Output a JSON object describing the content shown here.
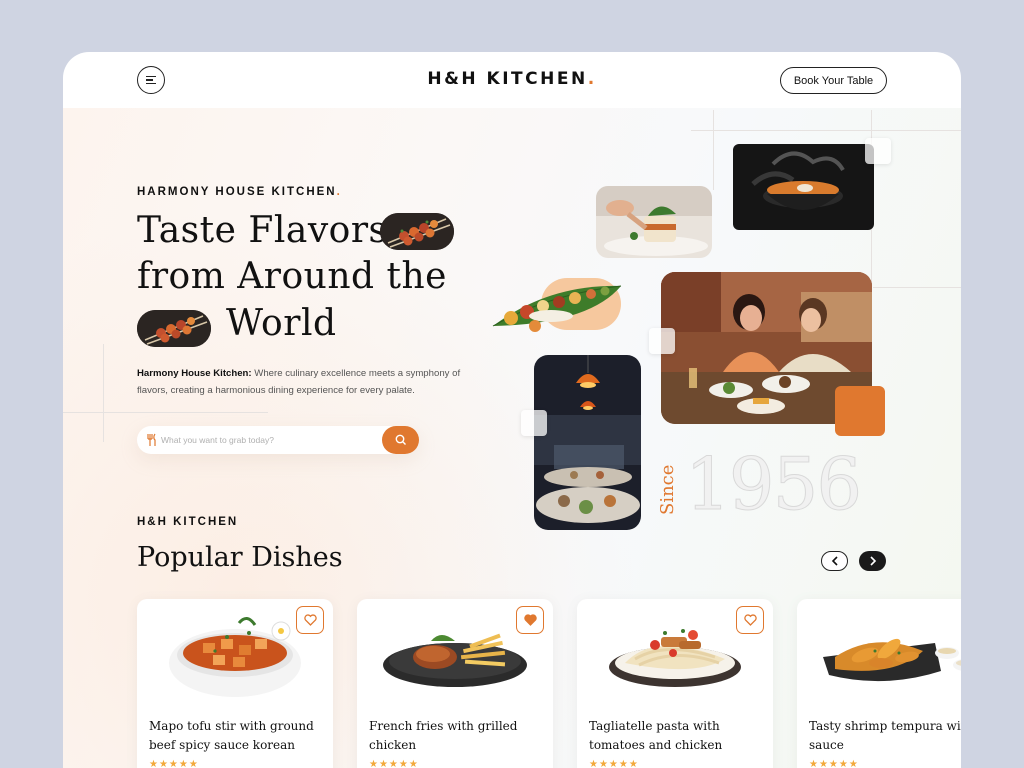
{
  "brand": {
    "logo": "H&H KITCHEN",
    "logo_dot": "."
  },
  "nav": {
    "book_label": "Book Your Table"
  },
  "hero": {
    "eyebrow": "HARMONY HOUSE KITCHEN",
    "eyebrow_dot": ".",
    "line1": "Taste Flavors",
    "line2": "from Around the",
    "line3": "World",
    "intro_bold": "Harmony House Kitchen:",
    "intro_text": " Where culinary excellence meets a symphony of flavors, creating a harmonious dining experience for every palate.",
    "search_placeholder": "What you want to grab today?",
    "since_label": "Since",
    "since_year": "1956"
  },
  "popular": {
    "eyebrow": "H&H KITCHEN",
    "title": "Popular Dishes",
    "dishes": [
      {
        "name": "Mapo tofu stir with ground beef spicy sauce korean",
        "favorited": false,
        "rating": "★★★★★"
      },
      {
        "name": "French fries with grilled chicken",
        "favorited": true,
        "rating": "★★★★★"
      },
      {
        "name": "Tagliatelle pasta with tomatoes and chicken",
        "favorited": false,
        "rating": "★★★★★"
      },
      {
        "name": "Tasty shrimp tempura with sauce",
        "favorited": false,
        "rating": "★★★★★"
      }
    ]
  },
  "colors": {
    "accent": "#e0782f",
    "text": "#111111",
    "background": "#cfd4e2"
  }
}
